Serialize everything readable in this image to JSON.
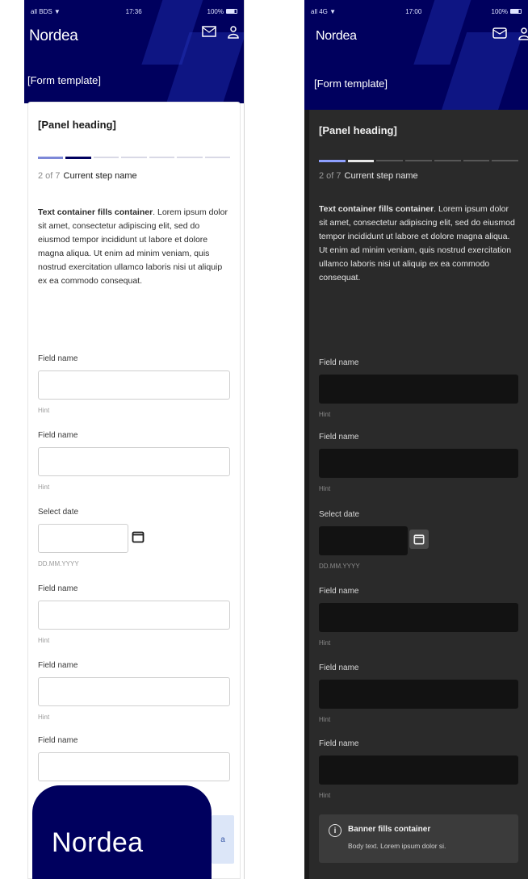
{
  "light": {
    "status": {
      "left": "all BDS ▼",
      "time": "17:36",
      "right": "100%"
    },
    "brand": "Nordea",
    "form_title": "[Form template]",
    "panel_heading": "[Panel heading]",
    "step_count": "2 of 7",
    "step_name": "Current step name",
    "body_bold": "Text container fills container",
    "body_text": ". Lorem ipsum dolor sit amet, consectetur adipiscing elit, sed do eiusmod tempor incididunt ut labore et dolore magna aliqua. Ut enim ad minim veniam, quis nostrud exercitation ullamco laboris nisi ut aliquip ex ea commodo consequat.",
    "fields": [
      {
        "label": "Field name",
        "hint": "Hint"
      },
      {
        "label": "Field name",
        "hint": "Hint"
      },
      {
        "label": "Select date",
        "hint": "DD.MM.YYYY",
        "type": "date"
      },
      {
        "label": "Field name",
        "hint": "Hint"
      },
      {
        "label": "Field name",
        "hint": "Hint"
      },
      {
        "label": "Field name",
        "hint": ""
      }
    ],
    "app_icon_text": "Nordea",
    "button_fragment": "a"
  },
  "dark": {
    "status": {
      "left": "all 4G ▼",
      "time": "17:00",
      "right": "100%"
    },
    "brand": "Nordea",
    "form_title": "[Form template]",
    "panel_heading": "[Panel heading]",
    "step_count": "2 of 7",
    "step_name": "Current step name",
    "body_bold": "Text container fills container",
    "body_text": ". Lorem ipsum dolor sit amet, consectetur adipiscing elit, sed do eiusmod tempor incididunt ut labore et dolore magna aliqua. Ut enim ad minim veniam, quis nostrud exercitation ullamco laboris nisi ut aliquip ex ea commodo consequat.",
    "fields": [
      {
        "label": "Field name",
        "hint": "Hint"
      },
      {
        "label": "Field name",
        "hint": "Hint"
      },
      {
        "label": "Select date",
        "hint": "DD.MM.YYYY",
        "type": "date"
      },
      {
        "label": "Field name",
        "hint": "Hint"
      },
      {
        "label": "Field name",
        "hint": "Hint"
      },
      {
        "label": "Field name",
        "hint": "Hint"
      }
    ],
    "info_title": "Banner fills container",
    "info_text": "Body text. Lorem ipsum dolor si.",
    "info_icon": "info-icon"
  },
  "colors": {
    "brand_navy": "#00005e",
    "dark_bg": "#1b1b1b",
    "dark_panel": "#2a2a2a",
    "step_active_light": "#00005e"
  },
  "step_progress": {
    "current": 2,
    "total": 7
  }
}
